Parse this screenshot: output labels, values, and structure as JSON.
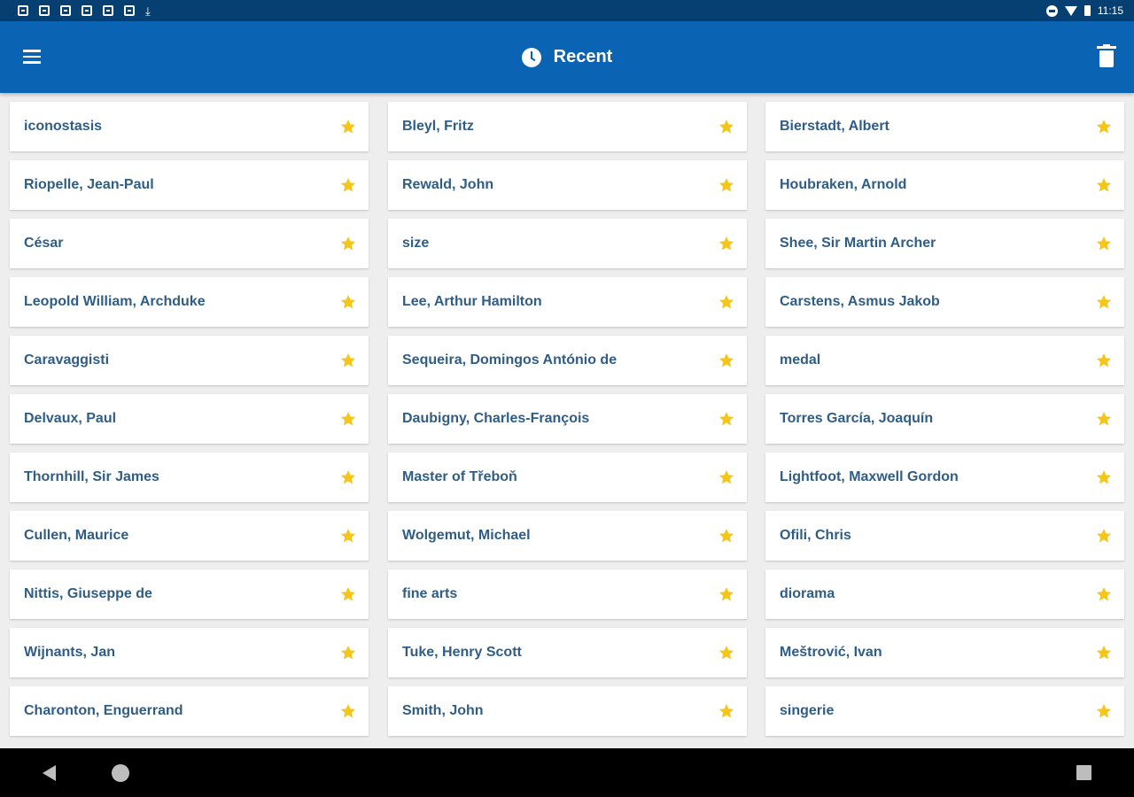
{
  "status_bar": {
    "time": "11:15",
    "notification_icons": [
      "notification-icon",
      "notification-icon",
      "notification-icon",
      "notification-icon",
      "notification-icon",
      "notification-icon",
      "download-icon"
    ]
  },
  "app_bar": {
    "title": "Recent",
    "menu_icon": "menu-icon",
    "title_icon": "clock-icon",
    "action_icon": "trash-icon",
    "color": "#0b63b3"
  },
  "columns": [
    [
      "iconostasis",
      "Riopelle, Jean-Paul",
      "César",
      "Leopold William, Archduke",
      "Caravaggisti",
      "Delvaux, Paul",
      "Thornhill, Sir James",
      "Cullen, Maurice",
      "Nittis, Giuseppe de",
      "Wijnants, Jan",
      "Charonton, Enguerrand"
    ],
    [
      "Bleyl, Fritz",
      "Rewald, John",
      "size",
      "Lee, Arthur Hamilton",
      "Sequeira, Domingos António de",
      "Daubigny, Charles-François",
      "Master of Třeboň",
      "Wolgemut, Michael",
      "fine arts",
      "Tuke, Henry Scott",
      "Smith, John"
    ],
    [
      "Bierstadt, Albert",
      "Houbraken, Arnold",
      "Shee, Sir Martin Archer",
      "Carstens, Asmus Jakob",
      "medal",
      "Torres García, Joaquín",
      "Lightfoot, Maxwell Gordon",
      "Ofili, Chris",
      "diorama",
      "Meštrović, Ivan",
      "singerie"
    ]
  ],
  "star_color": "#f5c518",
  "text_color": "#2f5d86",
  "nav_bar": {
    "icons": [
      "back-icon",
      "home-icon",
      "recents-icon"
    ]
  }
}
